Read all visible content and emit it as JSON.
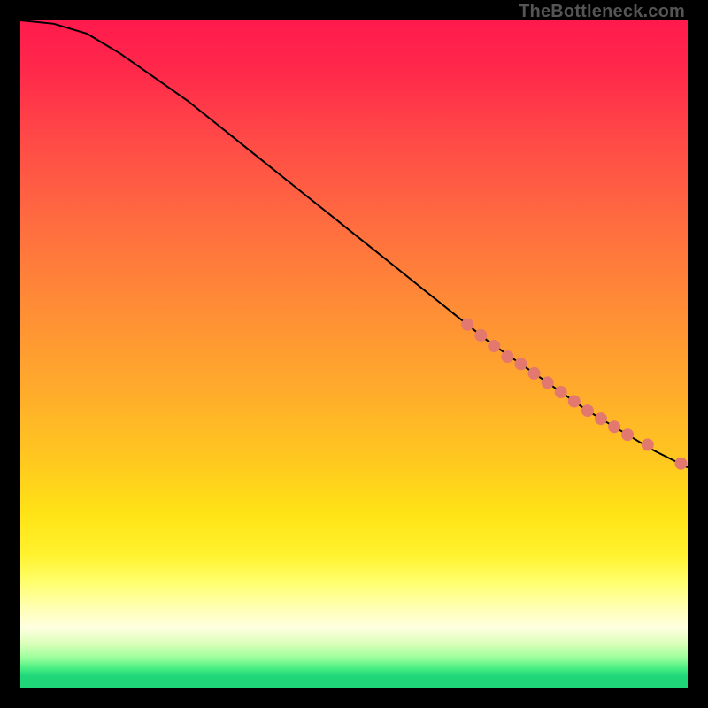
{
  "credit": "TheBottleneck.com",
  "colors": {
    "curve": "#000000",
    "point_fill": "#e2786e",
    "point_stroke": "#7a2d2a",
    "frame": "#000000"
  },
  "chart_data": {
    "type": "line",
    "title": "",
    "xlabel": "",
    "ylabel": "",
    "xlim": [
      0,
      100
    ],
    "ylim": [
      0,
      100
    ],
    "grid": false,
    "series": [
      {
        "name": "curve",
        "x": [
          0,
          5,
          10,
          15,
          20,
          25,
          30,
          35,
          40,
          45,
          50,
          55,
          60,
          65,
          70,
          75,
          80,
          85,
          90,
          95,
          100
        ],
        "y": [
          100,
          99.5,
          98,
          95,
          91.5,
          88,
          84,
          80,
          76,
          72,
          68,
          64,
          60,
          56,
          52,
          48.5,
          45,
          41.5,
          38.5,
          35.5,
          33
        ]
      }
    ],
    "points": {
      "name": "highlighted-range",
      "x": [
        67,
        69,
        71,
        73,
        75,
        77,
        79,
        81,
        83,
        85,
        87,
        89,
        91,
        94,
        99
      ],
      "y": [
        54.4,
        52.8,
        51.2,
        49.6,
        48.5,
        47.1,
        45.7,
        44.3,
        42.9,
        41.5,
        40.3,
        39.1,
        37.9,
        36.4,
        33.6
      ]
    }
  }
}
